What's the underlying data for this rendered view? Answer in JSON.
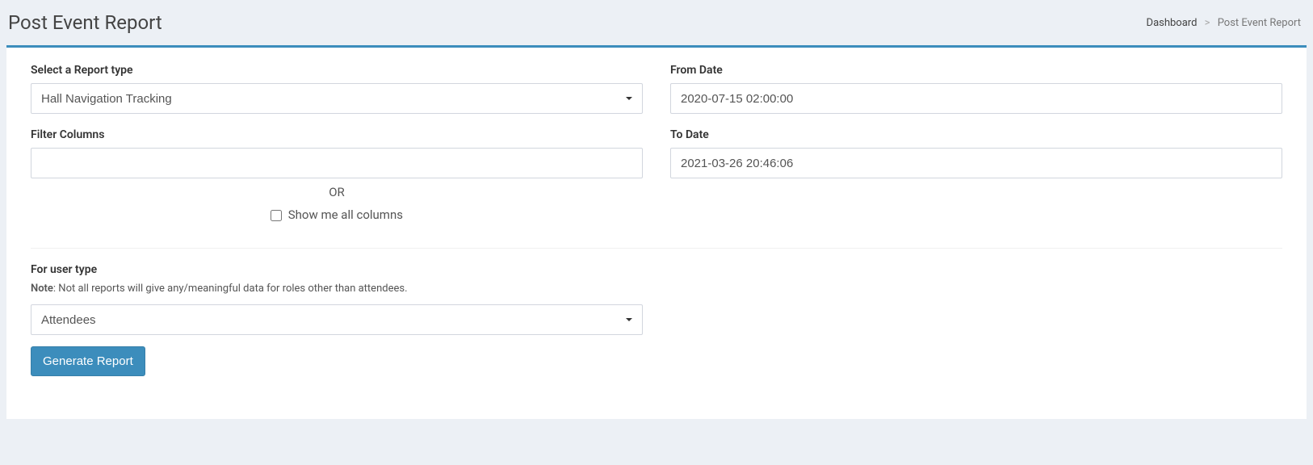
{
  "header": {
    "title": "Post Event Report"
  },
  "breadcrumb": {
    "dashboard": "Dashboard",
    "current": "Post Event Report"
  },
  "form": {
    "report_type": {
      "label": "Select a Report type",
      "selected": "Hall Navigation Tracking"
    },
    "from_date": {
      "label": "From Date",
      "value": "2020-07-15 02:00:00"
    },
    "to_date": {
      "label": "To Date",
      "value": "2021-03-26 20:46:06"
    },
    "filter_columns": {
      "label": "Filter Columns",
      "value": ""
    },
    "or_text": "OR",
    "show_all_columns": {
      "label": "Show me all columns",
      "checked": false
    },
    "user_type": {
      "label": "For user type",
      "note_prefix": "Note",
      "note_text": ": Not all reports will give any/meaningful data for roles other than attendees.",
      "selected": "Attendees"
    },
    "submit_label": "Generate Report"
  }
}
